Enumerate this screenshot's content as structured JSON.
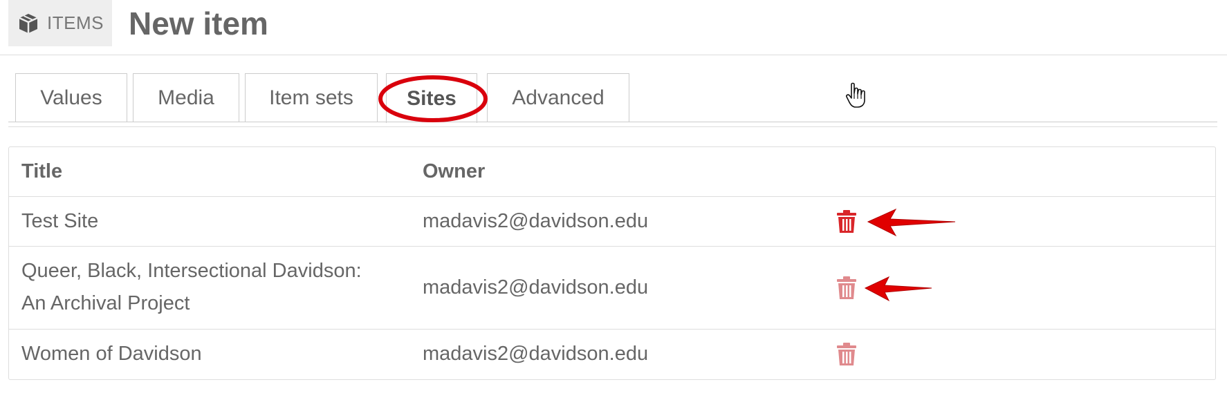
{
  "header": {
    "section_label": "ITEMS",
    "section_icon": "cube-icon",
    "title": "New item"
  },
  "tabs": [
    {
      "label": "Values"
    },
    {
      "label": "Media"
    },
    {
      "label": "Item sets"
    },
    {
      "label": "Sites",
      "active": true
    },
    {
      "label": "Advanced"
    }
  ],
  "table": {
    "columns": [
      "Title",
      "Owner"
    ],
    "rows": [
      {
        "title": "Test Site",
        "owner": "madavis2@davidson.edu"
      },
      {
        "title_line1": "Queer, Black, Intersectional Davidson:",
        "title_line2": "An Archival Project",
        "owner": "madavis2@davidson.edu"
      },
      {
        "title": "Women of Davidson",
        "owner": "madavis2@davidson.edu"
      }
    ]
  },
  "colors": {
    "delete_icon_active": "#d9262a",
    "delete_icon_faded": "#e08a8d",
    "annotation_red": "#e00000"
  }
}
